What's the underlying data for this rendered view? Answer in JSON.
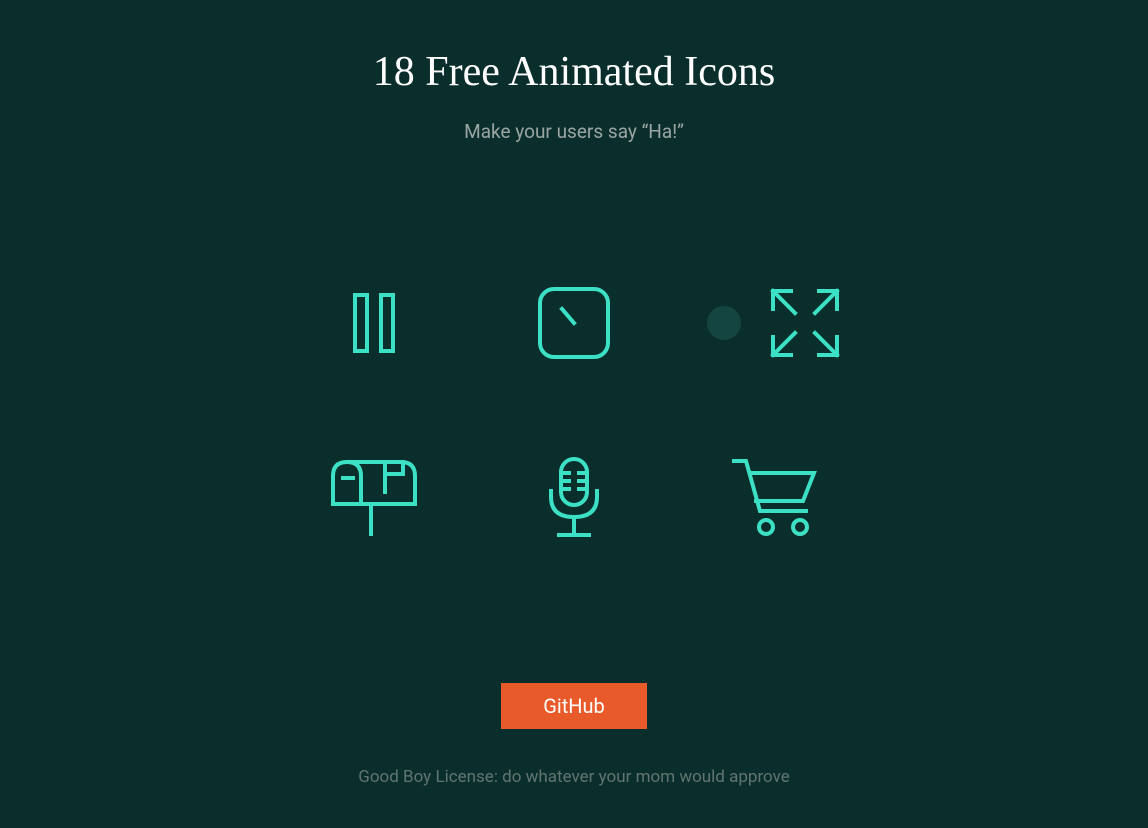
{
  "header": {
    "title": "18 Free Animated Icons",
    "subtitle": "Make your users say “Ha!”"
  },
  "icons": [
    {
      "name": "pause-icon"
    },
    {
      "name": "clock-icon"
    },
    {
      "name": "expand-icon"
    },
    {
      "name": "mailbox-icon"
    },
    {
      "name": "microphone-icon"
    },
    {
      "name": "cart-icon"
    }
  ],
  "cta": {
    "github_label": "GitHub"
  },
  "footer": {
    "license_text": "Good Boy License: do whatever your mom would approve"
  },
  "colors": {
    "background": "#0a2e2b",
    "icon_stroke": "#3ce0c4",
    "button_bg": "#e85a2a",
    "subtitle": "#9aa6a4",
    "footer_text": "#627471"
  }
}
